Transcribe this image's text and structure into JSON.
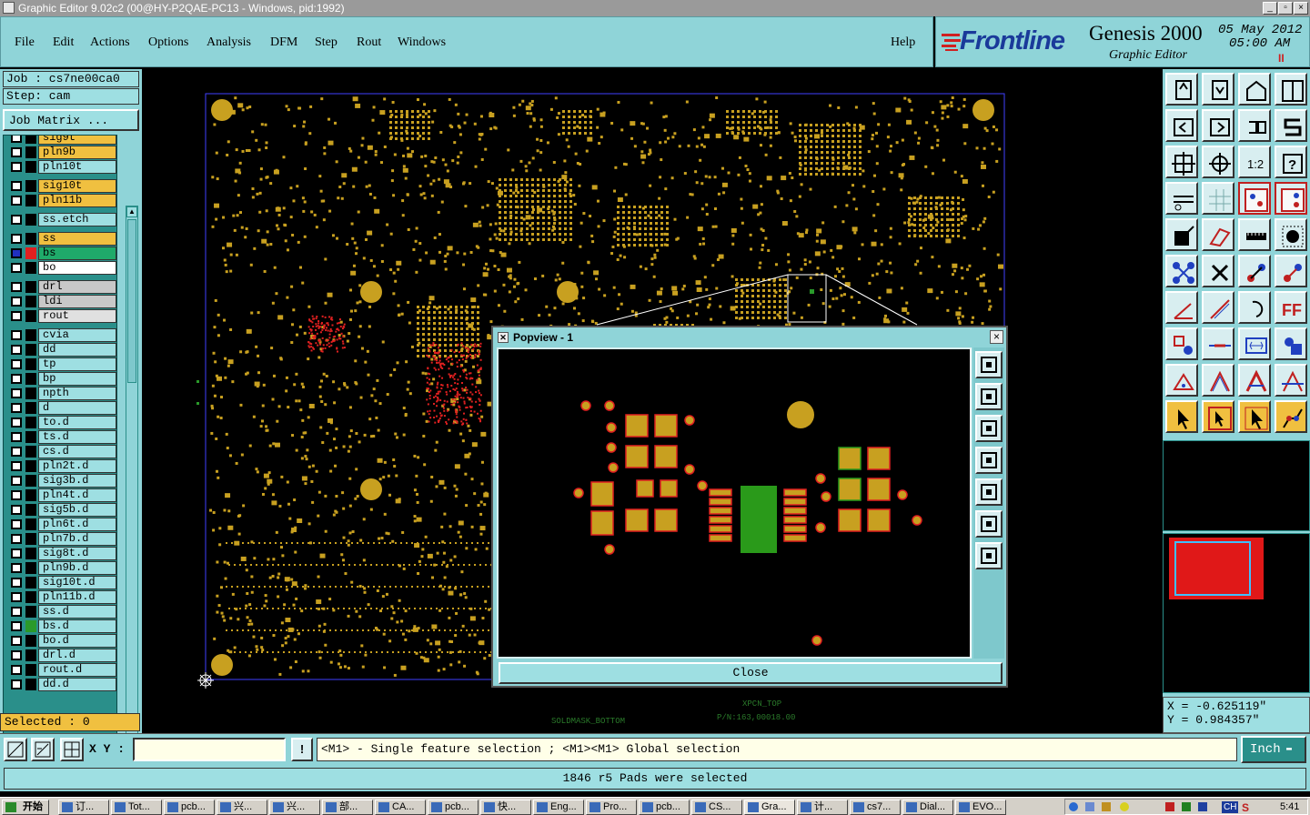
{
  "window": {
    "title": "Graphic Editor 9.02c2 (00@HY-P2QAE-PC13 - Windows, pid:1992)",
    "controls": [
      "_",
      "▫",
      "×"
    ]
  },
  "menu": {
    "items": [
      "File",
      "Edit",
      "Actions",
      "Options",
      "Analysis",
      "DFM",
      "Step",
      "Rout",
      "Windows"
    ],
    "help": "Help"
  },
  "brand": {
    "logo": "Frontline",
    "product": "Genesis 2000",
    "subtitle": "Graphic Editor",
    "date": "05 May 2012",
    "time": "05:00 AM",
    "pause": "II"
  },
  "job": {
    "job_label": "Job : cs7ne00ca0",
    "step_label": "Step: cam",
    "matrix_button": "Job Matrix ..."
  },
  "layers": [
    {
      "name": "sig9t",
      "fill": "#f0c040",
      "swatch": "#000"
    },
    {
      "name": "pln9b",
      "fill": "#f0c040",
      "swatch": "#000"
    },
    {
      "name": "pln10t",
      "fill": "#9edfe2",
      "swatch": "#000"
    },
    {
      "name": "sig10t",
      "fill": "#f0c040",
      "swatch": "#000"
    },
    {
      "name": "pln11b",
      "fill": "#f0c040",
      "swatch": "#000"
    },
    {
      "name": "ss.etch",
      "fill": "#9edfe2",
      "swatch": "#000"
    },
    {
      "name": "ss",
      "fill": "#f0c040",
      "swatch": "#000"
    },
    {
      "name": "bs",
      "fill": "#1faa6a",
      "swatch": "#e02020",
      "checked": true
    },
    {
      "name": "bo",
      "fill": "#ffffff",
      "swatch": "#000"
    },
    {
      "name": "drl",
      "fill": "#c8c8c8",
      "swatch": "#000"
    },
    {
      "name": "ldi",
      "fill": "#c8c8c8",
      "swatch": "#000"
    },
    {
      "name": "rout",
      "fill": "#e0e0e0",
      "swatch": "#000"
    },
    {
      "name": "cvia",
      "fill": "#9edfe2",
      "swatch": "#000"
    },
    {
      "name": "dd",
      "fill": "#9edfe2",
      "swatch": "#000"
    },
    {
      "name": "tp",
      "fill": "#9edfe2",
      "swatch": "#000"
    },
    {
      "name": "bp",
      "fill": "#9edfe2",
      "swatch": "#000"
    },
    {
      "name": "npth",
      "fill": "#9edfe2",
      "swatch": "#000"
    },
    {
      "name": "d",
      "fill": "#9edfe2",
      "swatch": "#000"
    },
    {
      "name": "to.d",
      "fill": "#9edfe2",
      "swatch": "#000"
    },
    {
      "name": "ts.d",
      "fill": "#9edfe2",
      "swatch": "#000"
    },
    {
      "name": "cs.d",
      "fill": "#9edfe2",
      "swatch": "#000"
    },
    {
      "name": "pln2t.d",
      "fill": "#9edfe2",
      "swatch": "#000"
    },
    {
      "name": "sig3b.d",
      "fill": "#9edfe2",
      "swatch": "#000"
    },
    {
      "name": "pln4t.d",
      "fill": "#9edfe2",
      "swatch": "#000"
    },
    {
      "name": "sig5b.d",
      "fill": "#9edfe2",
      "swatch": "#000"
    },
    {
      "name": "pln6t.d",
      "fill": "#9edfe2",
      "swatch": "#000"
    },
    {
      "name": "pln7b.d",
      "fill": "#9edfe2",
      "swatch": "#000"
    },
    {
      "name": "sig8t.d",
      "fill": "#9edfe2",
      "swatch": "#000"
    },
    {
      "name": "pln9b.d",
      "fill": "#9edfe2",
      "swatch": "#000"
    },
    {
      "name": "sig10t.d",
      "fill": "#9edfe2",
      "swatch": "#000"
    },
    {
      "name": "pln11b.d",
      "fill": "#9edfe2",
      "swatch": "#000"
    },
    {
      "name": "ss.d",
      "fill": "#9edfe2",
      "swatch": "#000"
    },
    {
      "name": "bs.d",
      "fill": "#9edfe2",
      "swatch": "#2a9a2a"
    },
    {
      "name": "bo.d",
      "fill": "#9edfe2",
      "swatch": "#000"
    },
    {
      "name": "drl.d",
      "fill": "#9edfe2",
      "swatch": "#000"
    },
    {
      "name": "rout.d",
      "fill": "#9edfe2",
      "swatch": "#000"
    },
    {
      "name": "dd.d",
      "fill": "#9edfe2",
      "swatch": "#000"
    }
  ],
  "selected": "Selected : 0",
  "canvas": {
    "label_top": "XPCN_TOP",
    "label_pn": "P/N:163,00018.00",
    "label_bottom": "SOLDMASK_BOTTOM"
  },
  "popview": {
    "title": "Popview - 1",
    "close": "Close"
  },
  "coords": {
    "x": "X = -0.625119\"",
    "y": "Y = 0.984357\""
  },
  "status": {
    "xy_label": "X Y :",
    "xy_value": "",
    "hint": "<M1> - Single feature selection ; <M1><M1> Global selection",
    "unit": "Inch"
  },
  "message": "1846 r5 Pads were selected",
  "taskbar": {
    "start": "开始",
    "items": [
      "订...",
      "Tot...",
      "pcb...",
      "兴...",
      "兴...",
      "部...",
      "CA...",
      "pcb...",
      "快...",
      "Eng...",
      "Pro...",
      "pcb...",
      "CS...",
      "Gra...",
      "计...",
      "cs7...",
      "Dial...",
      "EVO..."
    ],
    "lang": "CH",
    "clock": "5:41"
  },
  "colors": {
    "panel": "#8fd4d8",
    "pad": "#c8a020",
    "highlight": "#e02020",
    "selected_layer": "#1faa6a"
  }
}
